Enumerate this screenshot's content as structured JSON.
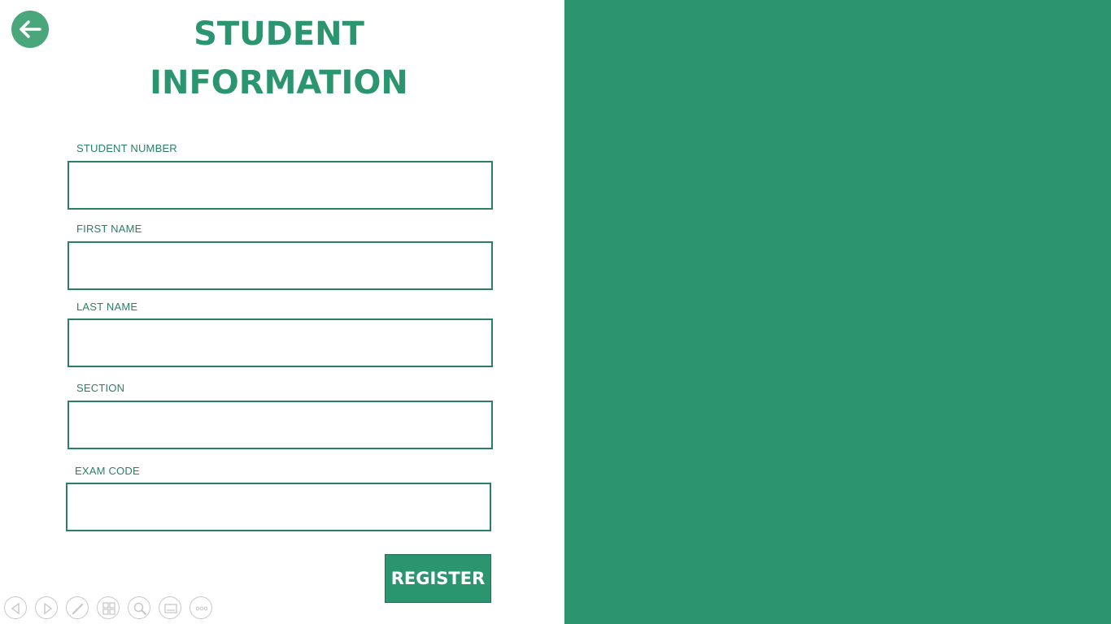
{
  "title": {
    "line1": "STUDENT",
    "line2": "INFORMATION"
  },
  "form": {
    "fields": [
      {
        "label": "STUDENT NUMBER",
        "value": ""
      },
      {
        "label": "FIRST NAME",
        "value": ""
      },
      {
        "label": "LAST NAME",
        "value": ""
      },
      {
        "label": "SECTION",
        "value": ""
      },
      {
        "label": "EXAM CODE",
        "value": ""
      }
    ],
    "register_label": "REGISTER"
  },
  "icons": {
    "back": "arrow-left-icon",
    "toolbar": [
      "previous-icon",
      "next-icon",
      "pen-icon",
      "slides-icon",
      "zoom-icon",
      "subtitles-icon",
      "more-icon"
    ]
  },
  "colors": {
    "accent": "#2b9570",
    "back_button": "#4aa77b",
    "border": "#2b8063",
    "background": "#ffffff"
  }
}
